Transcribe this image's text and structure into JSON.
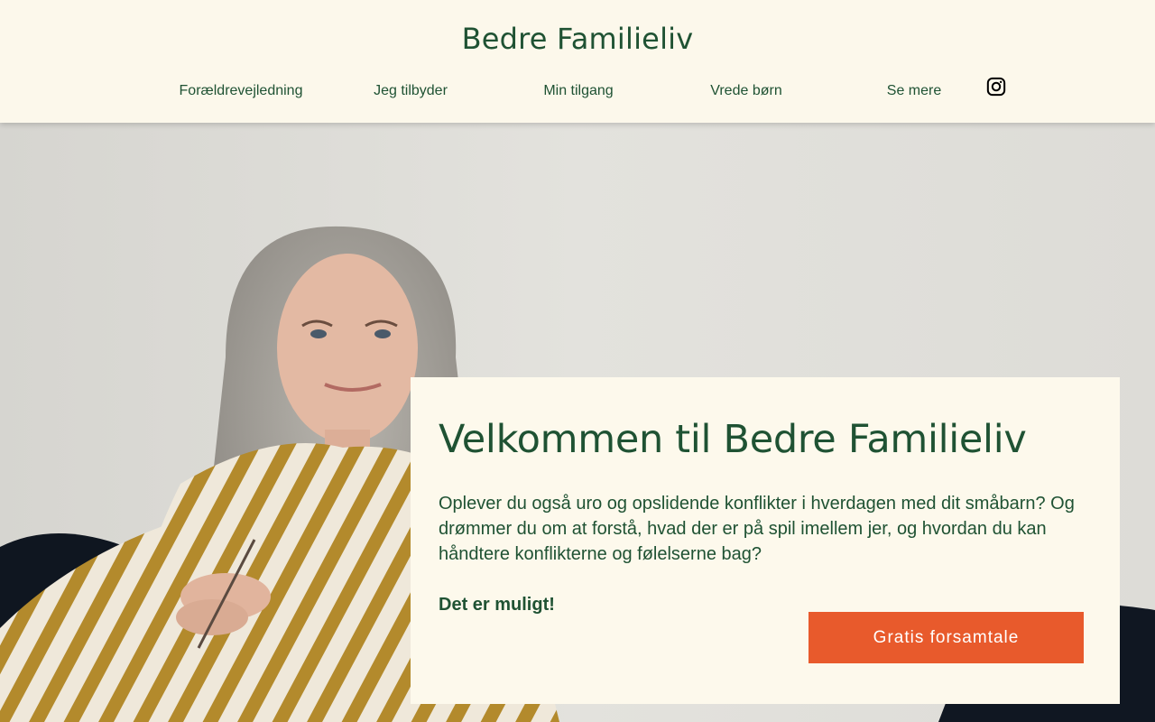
{
  "header": {
    "site_title": "Bedre Familieliv",
    "nav": [
      {
        "label": "Forældrevejledning"
      },
      {
        "label": "Jeg tilbyder"
      },
      {
        "label": "Min tilgang"
      },
      {
        "label": "Vrede børn"
      },
      {
        "label": "Se mere"
      }
    ],
    "social_icon": "instagram-icon"
  },
  "hero": {
    "image": "portrait-photo",
    "card": {
      "heading": "Velkommen til Bedre Familieliv",
      "body": "Oplever du også uro og opslidende konflikter i hverdagen med dit småbarn? Og drømmer du om at forstå, hvad der er på spil imellem jer, og hvordan du kan håndtere konflikterne og følelserne bag?",
      "emphasis": "Det er muligt!",
      "cta_label": "Gratis forsamtale"
    }
  },
  "colors": {
    "background": "#fcf8eb",
    "brand_green": "#1f5233",
    "cta_orange": "#e85a2c"
  }
}
